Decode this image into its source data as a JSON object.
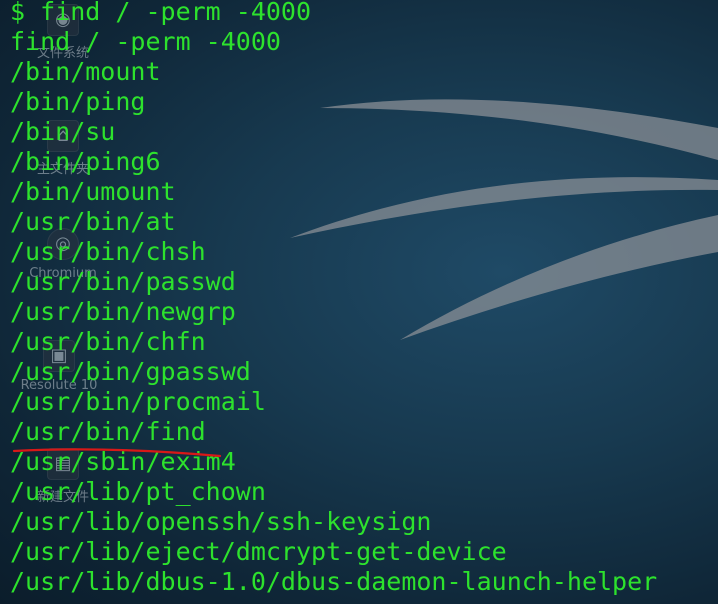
{
  "terminal": {
    "prompt": "$ find / -perm -4000",
    "echo": "find / -perm -4000",
    "output": [
      "/bin/mount",
      "/bin/ping",
      "/bin/su",
      "/bin/ping6",
      "/bin/umount",
      "/usr/bin/at",
      "/usr/bin/chsh",
      "/usr/bin/passwd",
      "/usr/bin/newgrp",
      "/usr/bin/chfn",
      "/usr/bin/gpasswd",
      "/usr/bin/procmail",
      "/usr/bin/find",
      "/usr/sbin/exim4",
      "/usr/lib/pt_chown",
      "/usr/lib/openssh/ssh-keysign",
      "/usr/lib/eject/dmcrypt-get-device",
      "/usr/lib/dbus-1.0/dbus-daemon-launch-helper"
    ],
    "text_color": "#2de22d"
  },
  "desktop_icons": [
    {
      "caption": "文件系统",
      "icon": "drive-icon"
    },
    {
      "caption": "主文件夹",
      "icon": "home-folder-icon"
    },
    {
      "caption": "Chromium",
      "icon": "chromium-icon"
    },
    {
      "caption": "Resolute 10",
      "icon": "app-icon"
    },
    {
      "caption": "新建文件",
      "icon": "file-icon"
    }
  ],
  "annotation": {
    "underline_color": "#d81818"
  }
}
